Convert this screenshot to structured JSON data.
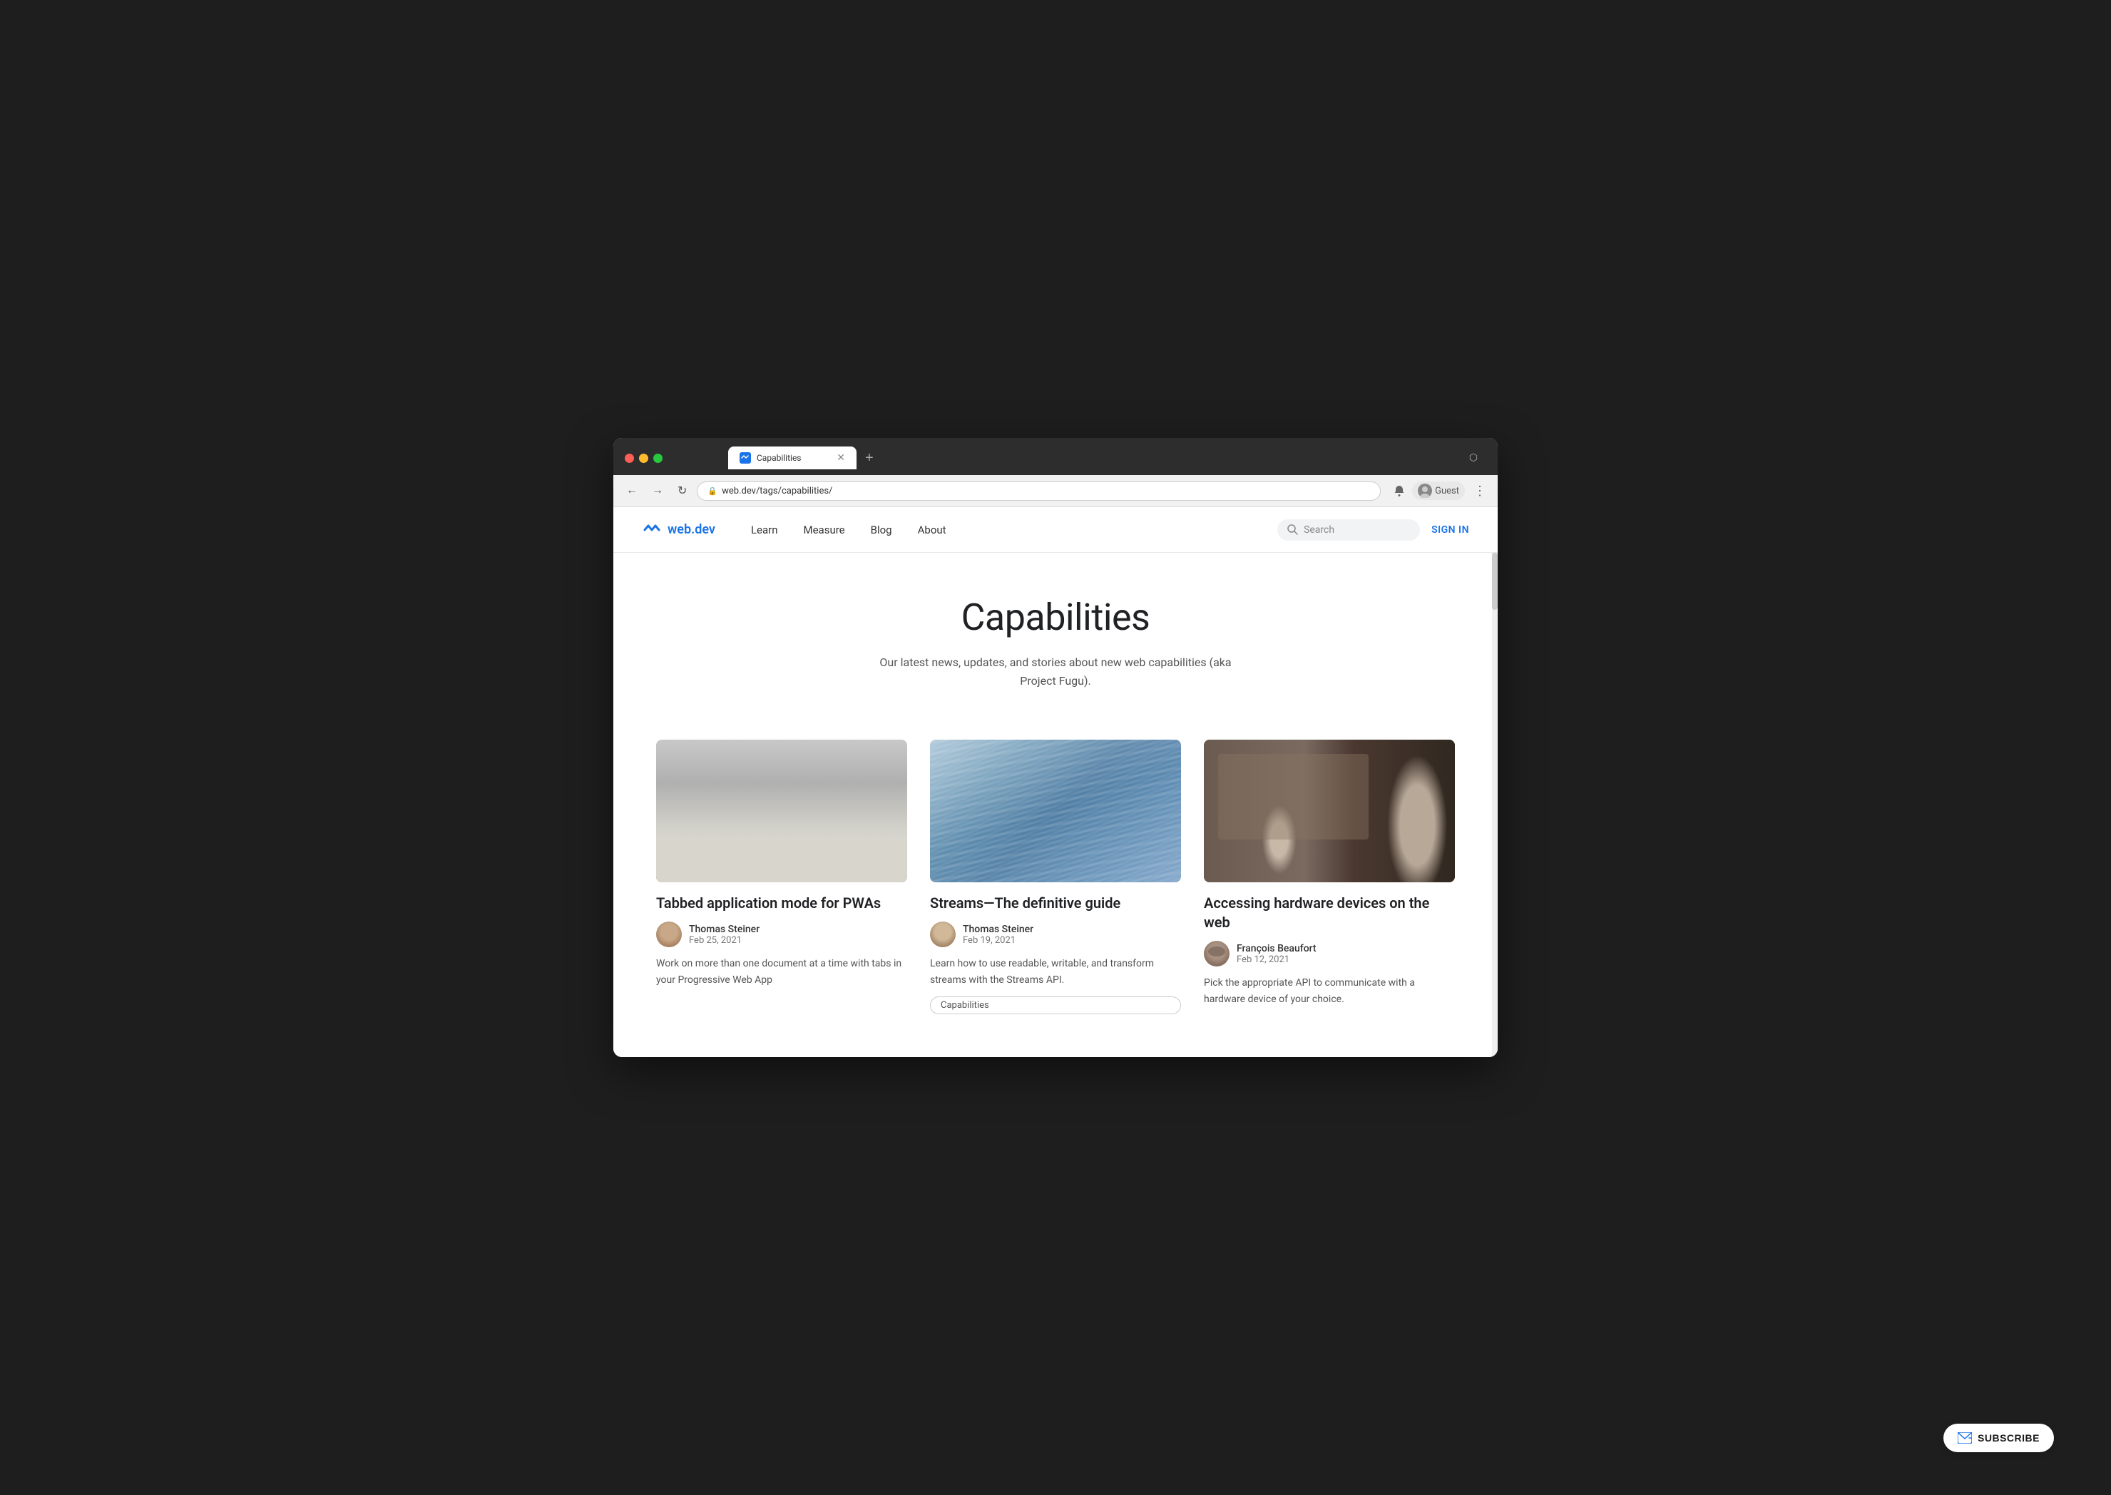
{
  "browser": {
    "tab_title": "Capabilities",
    "url": "web.dev/tags/capabilities/",
    "new_tab_label": "+",
    "back_label": "←",
    "forward_label": "→",
    "reload_label": "↻",
    "user_label": "Guest",
    "more_label": "⋮",
    "notification_icon": "🔔"
  },
  "nav": {
    "logo_text": "web.dev",
    "links": [
      {
        "label": "Learn"
      },
      {
        "label": "Measure"
      },
      {
        "label": "Blog"
      },
      {
        "label": "About"
      }
    ],
    "search_placeholder": "Search",
    "sign_in_label": "SIGN IN"
  },
  "hero": {
    "title": "Capabilities",
    "description": "Our latest news, updates, and stories about new web capabilities (aka Project Fugu)."
  },
  "articles": [
    {
      "title": "Tabbed application mode for PWAs",
      "author_name": "Thomas Steiner",
      "date": "Feb 25, 2021",
      "excerpt": "Work on more than one document at a time with tabs in your Progressive Web App",
      "tag": null,
      "image_class": "img-domes"
    },
    {
      "title": "Streams—The definitive guide",
      "author_name": "Thomas Steiner",
      "date": "Feb 19, 2021",
      "excerpt": "Learn how to use readable, writable, and transform streams with the Streams API.",
      "tag": "Capabilities",
      "image_class": "img-streams"
    },
    {
      "title": "Accessing hardware devices on the web",
      "author_name": "François Beaufort",
      "date": "Feb 12, 2021",
      "excerpt": "Pick the appropriate API to communicate with a hardware device of your choice.",
      "tag": null,
      "image_class": "img-workshop"
    }
  ],
  "subscribe": {
    "label": "SUBSCRIBE"
  }
}
